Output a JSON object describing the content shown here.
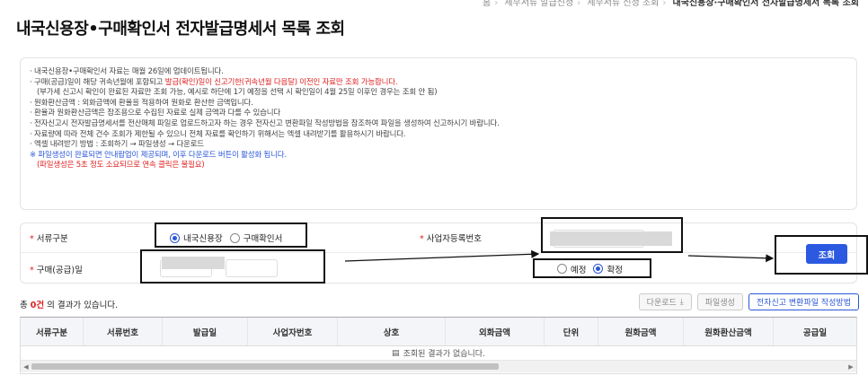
{
  "breadcrumb": [
    "홈",
    "세무서류 발급신청",
    "세무서류 신청 조회",
    "내국신용장·구매확인서 전자발급명세서 목록 조회"
  ],
  "page_title": "내국신용장•구매확인서 전자발급명세서 목록 조회",
  "notice": {
    "l1": "· 내국신용장•구매확인서 자료는 매월 26일에 업데이트됩니다.",
    "l2a": "· 구매(공급)일이 해당 귀속년월에 포함되고 ",
    "l2b": "발급(확인)일이 신고기한(귀속년월 다음달) 이전인 자료만 조회 가능합니다.",
    "l3": "(부가세 신고시 확인이 완료된 자료만 조회 가능, 예시로 하단에 1기 예정을 선택 시 확인일이 4월 25일 이후인 경우는 조회 안 됨)",
    "l4": "· 원화환산금액 : 외화금액에 환율을 적용하여 원화로 환산한 금액입니다.",
    "l5": "· 환율과 원화환산금액은 참조용으로 수집된 자료로 실제 금액과 다를 수 있습니다",
    "l6": "· 전자신고시 전자발급명세서를 전산매체 파일로 업로드하고자 하는 경우 전자신고 변환파일 작성방법을 참조하여 파일을 생성하여 신고하시기 바랍니다.",
    "l7": "· 자료량에 따라 전체 건수 조회가 제한될 수 있으니 전체 자료를 확인하기 위해서는 엑셀 내려받기를 활용하시기 바랍니다.",
    "l8": "· 엑셀 내려받기 방법 : 조회하기 → 파일생성 → 다운로드",
    "l9": "※ 파일생성이 완료되면 안내팝업이 제공되며, 이후  다운로드 버튼이 활성화 됩니다.",
    "l10": "(파일생성은 5초 정도 소요되므로 연속 클릭은 불필요)"
  },
  "form": {
    "doc_type_label": "서류구분",
    "doc_type_options": [
      "내국신용장",
      "구매확인서"
    ],
    "doc_type_selected": "내국신용장",
    "biz_no_label": "사업자등록번호",
    "purchase_date_label": "구매(공급)일",
    "period_options": [
      "예정",
      "확정"
    ],
    "period_selected": "확정",
    "search_button": "조회"
  },
  "result": {
    "prefix": "총 ",
    "count": "0건",
    "suffix": " 의 결과가 있습니다."
  },
  "toolbar": {
    "download": "다운로드",
    "file_create": "파일생성",
    "convert_guide": "전자신고 변환파일 작성방법"
  },
  "table": {
    "columns": [
      "서류구분",
      "서류번호",
      "발급일",
      "사업자번호",
      "상호",
      "외화금액",
      "단위",
      "원화금액",
      "원화환산금액",
      "공급일"
    ],
    "empty_message": "조회된 결과가 없습니다."
  },
  "colors": {
    "accent": "#2b59e0",
    "required": "#e02020"
  }
}
